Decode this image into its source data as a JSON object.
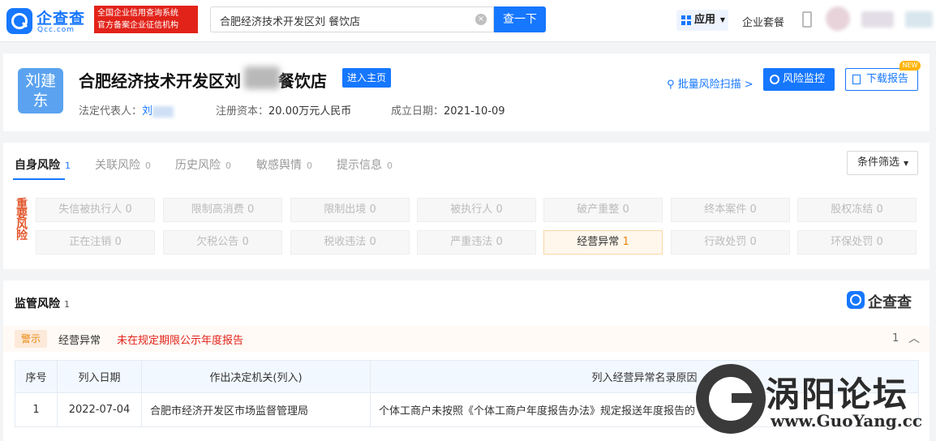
{
  "header": {
    "logo_cn": "企查查",
    "logo_en": "Qcc.com",
    "notice_line1": "全国企业信用查询系统",
    "notice_line2": "官方备案企业征信机构",
    "search_value": "合肥经济技术开发区刘  餐饮店",
    "search_button": "查一下",
    "apps_label": "应用",
    "suite_label": "企业套餐"
  },
  "company": {
    "avatar_text_line1": "刘建",
    "avatar_text_line2": "东",
    "name_prefix": "合肥经济技术开发区刘",
    "name_suffix": "餐饮店",
    "enter_home": "进入主页",
    "legal_rep_label": "法定代表人：",
    "legal_rep_value": "刘",
    "capital_label": "注册资本：",
    "capital_value": "20.00万元人民币",
    "founded_label": "成立日期：",
    "founded_value": "2021-10-09",
    "batch_scan": "批量风险扫描 >",
    "risk_monitor": "风险监控",
    "download_report": "下载报告",
    "new_badge": "NEW"
  },
  "risk": {
    "tabs": [
      {
        "label": "自身风险",
        "count": "1"
      },
      {
        "label": "关联风险",
        "count": "0"
      },
      {
        "label": "历史风险",
        "count": "0"
      },
      {
        "label": "敏感舆情",
        "count": "0"
      },
      {
        "label": "提示信息",
        "count": "0"
      }
    ],
    "filter_label": "条件筛选",
    "side_label": "重要风险",
    "row1": [
      {
        "label": "失信被执行人",
        "count": "0"
      },
      {
        "label": "限制高消费",
        "count": "0"
      },
      {
        "label": "限制出境",
        "count": "0"
      },
      {
        "label": "被执行人",
        "count": "0"
      },
      {
        "label": "破产重整",
        "count": "0"
      },
      {
        "label": "终本案件",
        "count": "0"
      },
      {
        "label": "股权冻结",
        "count": "0"
      }
    ],
    "row2": [
      {
        "label": "正在注销",
        "count": "0"
      },
      {
        "label": "欠税公告",
        "count": "0"
      },
      {
        "label": "税收违法",
        "count": "0"
      },
      {
        "label": "严重违法",
        "count": "0"
      },
      {
        "label": "经营异常",
        "count": "1"
      },
      {
        "label": "行政处罚",
        "count": "0"
      },
      {
        "label": "环保处罚",
        "count": "0"
      }
    ]
  },
  "supervision": {
    "title": "监管风险",
    "count": "1",
    "watermark": "企查查",
    "warn_tag": "警示",
    "warn_type": "经营异常",
    "warn_desc": "未在规定期限公示年度报告",
    "band_count": "1",
    "columns": [
      "序号",
      "列入日期",
      "作出决定机关(列入)",
      "列入经营异常名录原因"
    ],
    "rows": [
      [
        "1",
        "2022-07-04",
        "合肥市经济开发区市场监督管理局",
        "个体工商户未按照《个体工商户年度报告办法》规定报送年度报告的"
      ]
    ]
  },
  "forum": {
    "cn": "涡阳论坛",
    "en": "www.GuoYang.cc"
  },
  "colors": {
    "brand_blue": "#1677ff",
    "risk_orange": "#e8860c",
    "alert_red": "#e2231a"
  }
}
